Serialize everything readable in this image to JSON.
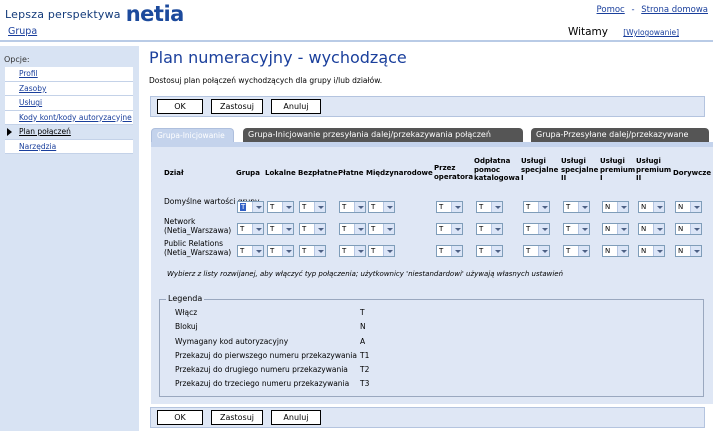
{
  "header": {
    "brand_tagline": "Lepsza perspektywa",
    "brand_logo": "netia",
    "links": [
      "Pomoc",
      "Strona domowa"
    ],
    "link_separator": "-",
    "group_link": "Grupa",
    "welcome": "Witamy",
    "logout": "[Wylogowanie]"
  },
  "sidebar": {
    "title": "Opcje:",
    "items": [
      {
        "label": "Profil",
        "active": false
      },
      {
        "label": "Zasoby",
        "active": false
      },
      {
        "label": "Usługi",
        "active": false
      },
      {
        "label": "Kody kont/kody autoryzacyjne",
        "active": false
      },
      {
        "label": "Plan połączeń",
        "active": true
      },
      {
        "label": "Narzędzia",
        "active": false
      }
    ]
  },
  "main": {
    "title": "Plan numeracyjny - wychodzące",
    "subtitle": "Dostosuj plan połączeń wychodzących dla grupy i/lub działów.",
    "buttons": {
      "ok": "OK",
      "apply": "Zastosuj",
      "cancel": "Anuluj"
    },
    "tabs": [
      {
        "label": "Grupa-Inicjowanie",
        "active": true
      },
      {
        "label": "Grupa-Inicjowanie przesyłania dalej/przekazywania połączeń",
        "active": false
      },
      {
        "label": "Grupa-Przesyłane dalej/przekazywane",
        "active": false
      }
    ],
    "table": {
      "columns": [
        "Dział",
        "Grupa",
        "Lokalne",
        "Bezpłatne",
        "Płatne",
        "Międzynarodowe",
        "Przez operatora",
        "Odpłatna pomoc katalogowa",
        "Usługi specjalne I",
        "Usługi specjalne II",
        "Usługi premium I",
        "Usługi premium II",
        "Dorywcze"
      ],
      "rows": [
        {
          "label": "Domyślne wartości grupy",
          "values": [
            "T",
            "T",
            "T",
            "T",
            "T",
            "T",
            "T",
            "T",
            "T",
            "N",
            "N",
            "N"
          ]
        },
        {
          "label": "Network (Netia_Warszawa)",
          "values": [
            "T",
            "T",
            "T",
            "T",
            "T",
            "T",
            "T",
            "T",
            "T",
            "N",
            "N",
            "N"
          ]
        },
        {
          "label": "Public Relations (Netia_Warszawa)",
          "values": [
            "T",
            "T",
            "T",
            "T",
            "T",
            "T",
            "T",
            "T",
            "T",
            "N",
            "N",
            "N"
          ]
        }
      ]
    },
    "hint": "Wybierz z listy rozwijanej, aby włączyć typ połączenia; użytkownicy 'niestandardowi' używają własnych ustawień",
    "legend": {
      "title": "Legenda",
      "items": [
        {
          "label": "Włącz",
          "code": "T"
        },
        {
          "label": "Blokuj",
          "code": "N"
        },
        {
          "label": "Wymagany kod autoryzacyjny",
          "code": "A"
        },
        {
          "label": "Przekazuj do pierwszego numeru przekazywania",
          "code": "T1"
        },
        {
          "label": "Przekazuj do drugiego numeru przekazywania",
          "code": "T2"
        },
        {
          "label": "Przekazuj do trzeciego numeru przekazywania",
          "code": "T3"
        }
      ]
    }
  },
  "colors": {
    "brand_blue": "#1c4a9c",
    "link_blue": "#1a3f9c",
    "sidebar_bg": "#d8e3f3",
    "panel_bg": "#dfe7f5",
    "inactive_tab": "#555555"
  }
}
